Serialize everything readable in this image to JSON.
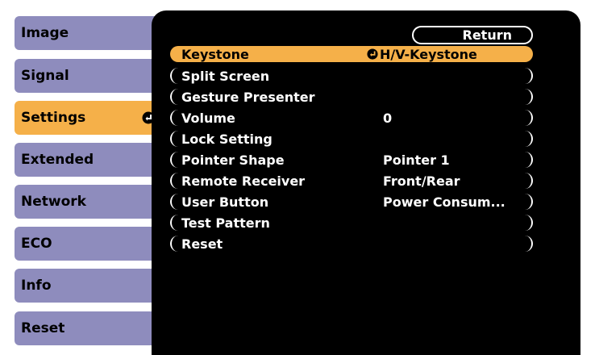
{
  "tabs": [
    {
      "label": "Image"
    },
    {
      "label": "Signal"
    },
    {
      "label": "Settings"
    },
    {
      "label": "Extended"
    },
    {
      "label": "Network"
    },
    {
      "label": "ECO"
    },
    {
      "label": "Info"
    },
    {
      "label": "Reset"
    }
  ],
  "active_tab": "Settings",
  "return_label": "Return",
  "menu": [
    {
      "name": "Keystone",
      "value": "H/V-Keystone"
    },
    {
      "name": "Split Screen",
      "value": ""
    },
    {
      "name": "Gesture Presenter",
      "value": ""
    },
    {
      "name": "Volume",
      "value": "0"
    },
    {
      "name": "Lock Setting",
      "value": ""
    },
    {
      "name": "Pointer Shape",
      "value": "Pointer 1"
    },
    {
      "name": "Remote Receiver",
      "value": "Front/Rear"
    },
    {
      "name": "User Button",
      "value": "Power Consum..."
    },
    {
      "name": "Test Pattern",
      "value": ""
    },
    {
      "name": "Reset",
      "value": ""
    }
  ],
  "colors": {
    "tab": "#8e8cbd",
    "accent": "#f5b049",
    "panel": "#000000"
  },
  "icons": {
    "enter": "enter-icon"
  }
}
